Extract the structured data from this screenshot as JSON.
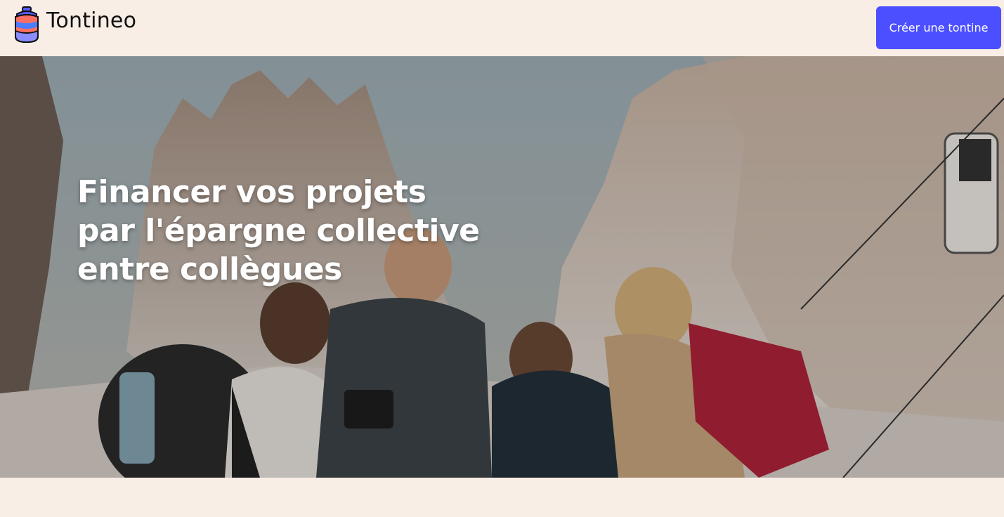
{
  "header": {
    "brand": "Tontineo",
    "logo_icon": "jar-icon",
    "cta_label": "Créer une tontine"
  },
  "hero": {
    "image": "group-of-hikers-laughing-in-mountains",
    "headline_lines": [
      "Financer vos projets",
      "par l'épargne collective",
      "entre collègues"
    ]
  },
  "colors": {
    "background": "#f9eee5",
    "accent": "#4b4fff",
    "text": "#111111"
  }
}
